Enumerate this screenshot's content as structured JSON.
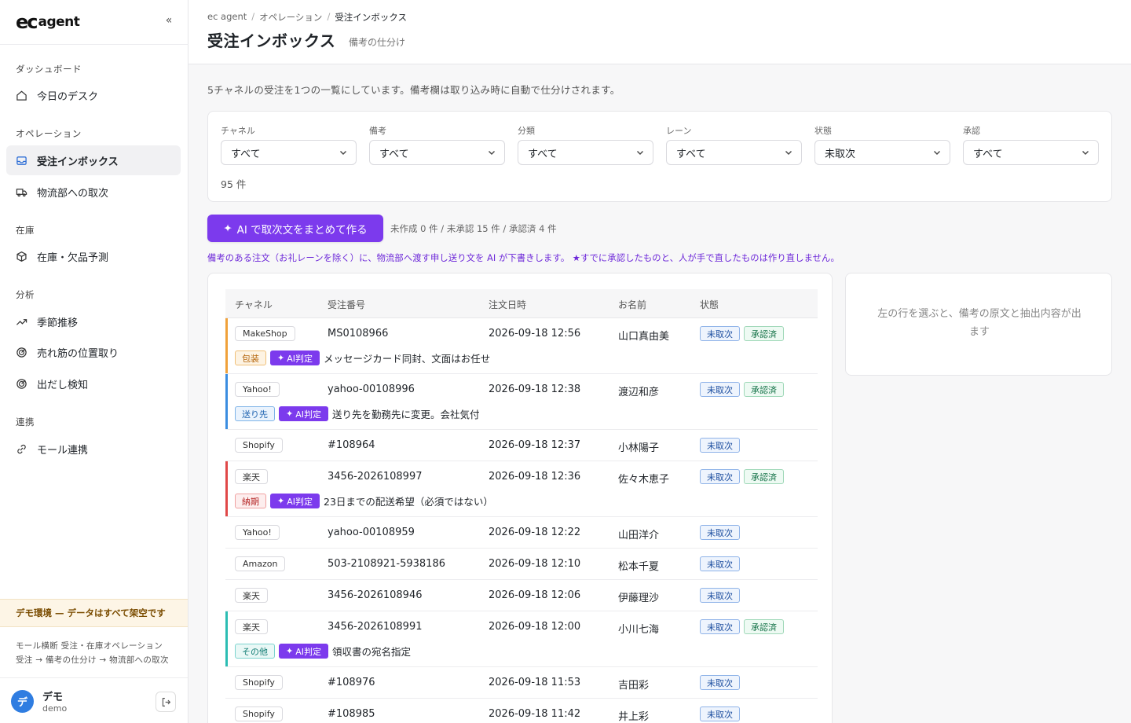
{
  "app": {
    "logo_mark": "ec",
    "logo_text": "agent",
    "collapse_icon": "«"
  },
  "sidebar": {
    "groups": [
      {
        "label": "ダッシュボード",
        "items": [
          {
            "label": "今日のデスク",
            "icon": "home-icon"
          }
        ]
      },
      {
        "label": "オペレーション",
        "items": [
          {
            "label": "受注インボックス",
            "icon": "inbox-icon",
            "active": true
          },
          {
            "label": "物流部への取次",
            "icon": "truck-icon"
          }
        ]
      },
      {
        "label": "在庫",
        "items": [
          {
            "label": "在庫・欠品予測",
            "icon": "box-icon"
          }
        ]
      },
      {
        "label": "分析",
        "items": [
          {
            "label": "季節推移",
            "icon": "trend-icon"
          },
          {
            "label": "売れ筋の位置取り",
            "icon": "target-icon"
          },
          {
            "label": "出だし検知",
            "icon": "target-icon"
          }
        ]
      },
      {
        "label": "連携",
        "items": [
          {
            "label": "モール連携",
            "icon": "link-icon"
          }
        ]
      }
    ],
    "demo_banner": "デモ環境 — データはすべて架空です",
    "desc_line1": "モール横断 受注・在庫オペレーション",
    "desc_line2": "受注 → 備考の仕分け → 物流部への取次",
    "user": {
      "avatar": "デ",
      "name": "デモ",
      "id": "demo"
    }
  },
  "header": {
    "breadcrumb": [
      "ec agent",
      "オペレーション",
      "受注インボックス"
    ],
    "title": "受注インボックス",
    "subtitle": "備考の仕分け"
  },
  "intro": "5チャネルの受注を1つの一覧にしています。備考欄は取り込み時に自動で仕分けされます。",
  "filters": [
    {
      "label": "チャネル",
      "value": "すべて"
    },
    {
      "label": "備考",
      "value": "すべて"
    },
    {
      "label": "分類",
      "value": "すべて"
    },
    {
      "label": "レーン",
      "value": "すべて"
    },
    {
      "label": "状態",
      "value": "未取次"
    },
    {
      "label": "承認",
      "value": "すべて"
    }
  ],
  "count": "95 件",
  "ai": {
    "button": "AI で取次文をまとめて作る",
    "status": "未作成 0 件 / 未承認 15 件 / 承認済 4 件",
    "note": "備考のある注文（お礼レーンを除く）に、物流部へ渡す申し送り文を AI が下書きします。 ★すでに承認したものと、人が手で直したものは作り直しません。"
  },
  "table": {
    "columns": [
      "チャネル",
      "受注番号",
      "注文日時",
      "お名前",
      "状態"
    ],
    "rows": [
      {
        "channel": "MakeShop",
        "order_no": "MS0108966",
        "datetime": "2026-09-18 12:56",
        "name": "山口真由美",
        "status": "未取次",
        "approval": "承認済",
        "note_tag": "包装",
        "note_color": "orange",
        "ai_tag": "AI判定",
        "note": "メッセージカード同封、文面はお任せ",
        "bar": "#f0a13a"
      },
      {
        "channel": "Yahoo!",
        "order_no": "yahoo-00108996",
        "datetime": "2026-09-18 12:38",
        "name": "渡辺和彦",
        "status": "未取次",
        "approval": "承認済",
        "note_tag": "送り先",
        "note_color": "blue",
        "ai_tag": "AI判定",
        "note": "送り先を勤務先に変更。会社気付",
        "bar": "#3b8de0"
      },
      {
        "channel": "Shopify",
        "order_no": "#108964",
        "datetime": "2026-09-18 12:37",
        "name": "小林陽子",
        "status": "未取次"
      },
      {
        "channel": "楽天",
        "order_no": "3456-2026108997",
        "datetime": "2026-09-18 12:36",
        "name": "佐々木恵子",
        "status": "未取次",
        "approval": "承認済",
        "note_tag": "納期",
        "note_color": "red",
        "ai_tag": "AI判定",
        "note": "23日までの配送希望（必須ではない）",
        "bar": "#e04848"
      },
      {
        "channel": "Yahoo!",
        "order_no": "yahoo-00108959",
        "datetime": "2026-09-18 12:22",
        "name": "山田洋介",
        "status": "未取次"
      },
      {
        "channel": "Amazon",
        "order_no": "503-2108921-5938186",
        "datetime": "2026-09-18 12:10",
        "name": "松本千夏",
        "status": "未取次"
      },
      {
        "channel": "楽天",
        "order_no": "3456-2026108946",
        "datetime": "2026-09-18 12:06",
        "name": "伊藤理沙",
        "status": "未取次"
      },
      {
        "channel": "楽天",
        "order_no": "3456-2026108991",
        "datetime": "2026-09-18 12:00",
        "name": "小川七海",
        "status": "未取次",
        "approval": "承認済",
        "note_tag": "その他",
        "note_color": "teal",
        "ai_tag": "AI判定",
        "note": "領収書の宛名指定",
        "bar": "#2bbdb3"
      },
      {
        "channel": "Shopify",
        "order_no": "#108976",
        "datetime": "2026-09-18 11:53",
        "name": "吉田彩",
        "status": "未取次"
      },
      {
        "channel": "Shopify",
        "order_no": "#108985",
        "datetime": "2026-09-18 11:42",
        "name": "井上彩",
        "status": "未取次"
      }
    ]
  },
  "detail": {
    "placeholder": "左の行を選ぶと、備考の原文と抽出内容が出ます"
  }
}
